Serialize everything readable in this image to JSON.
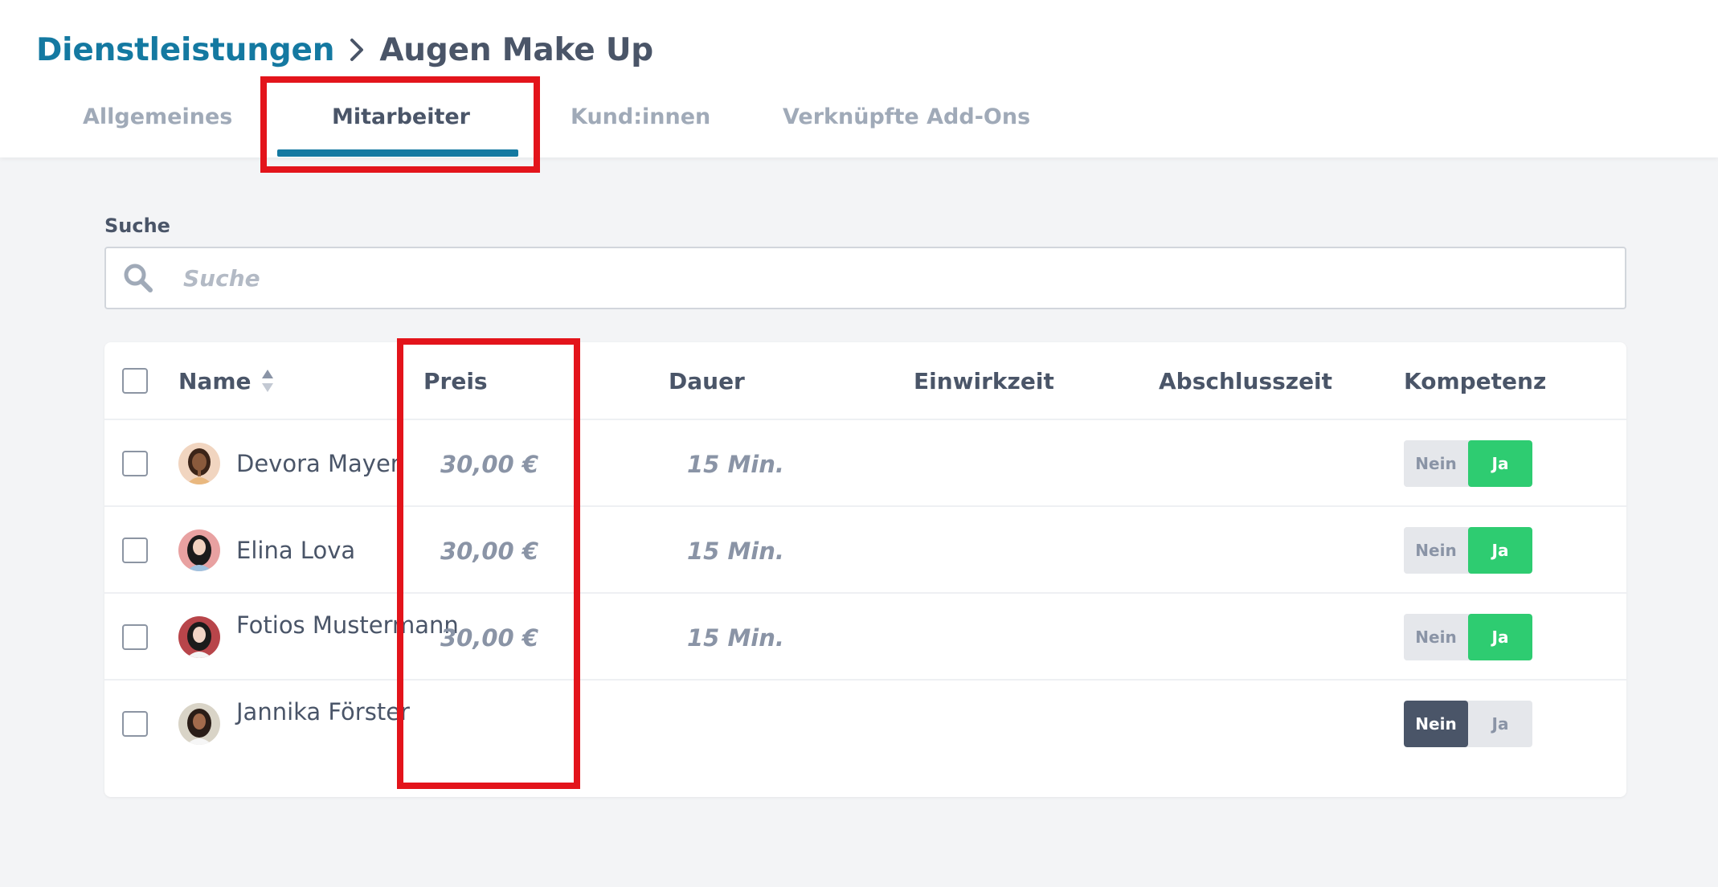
{
  "breadcrumb": {
    "parent": "Dienstleistungen",
    "current": "Augen Make Up"
  },
  "tabs": [
    {
      "label": "Allgemeines",
      "active": false
    },
    {
      "label": "Mitarbeiter",
      "active": true
    },
    {
      "label": "Kund:innen",
      "active": false
    },
    {
      "label": "Verknüpfte Add-Ons",
      "active": false
    }
  ],
  "search": {
    "label": "Suche",
    "placeholder": "Suche",
    "value": ""
  },
  "table": {
    "columns": [
      "Name",
      "Preis",
      "Dauer",
      "Einwirkzeit",
      "Abschlusszeit",
      "Kompetenz"
    ],
    "toggle_labels": {
      "no": "Nein",
      "yes": "Ja"
    },
    "rows": [
      {
        "name": "Devora Mayer",
        "price": "30,00 €",
        "duration": "15 Min.",
        "einwirkzeit": "",
        "abschlusszeit": "",
        "kompetenz": "Ja",
        "avatar": "avatar-woman-1"
      },
      {
        "name": "Elina Lova",
        "price": "30,00 €",
        "duration": "15 Min.",
        "einwirkzeit": "",
        "abschlusszeit": "",
        "kompetenz": "Ja",
        "avatar": "avatar-woman-2"
      },
      {
        "name": "Fotios Mustermann",
        "price": "30,00 €",
        "duration": "15 Min.",
        "einwirkzeit": "",
        "abschlusszeit": "",
        "kompetenz": "Ja",
        "avatar": "avatar-woman-3"
      },
      {
        "name": "Jannika Förster",
        "price": "",
        "duration": "",
        "einwirkzeit": "",
        "abschlusszeit": "",
        "kompetenz": "Nein",
        "avatar": "avatar-woman-4"
      }
    ]
  },
  "colors": {
    "accent": "#1479a1",
    "highlight": "#e3141b",
    "toggle_yes": "#2ecc71",
    "toggle_no": "#4a5568"
  }
}
